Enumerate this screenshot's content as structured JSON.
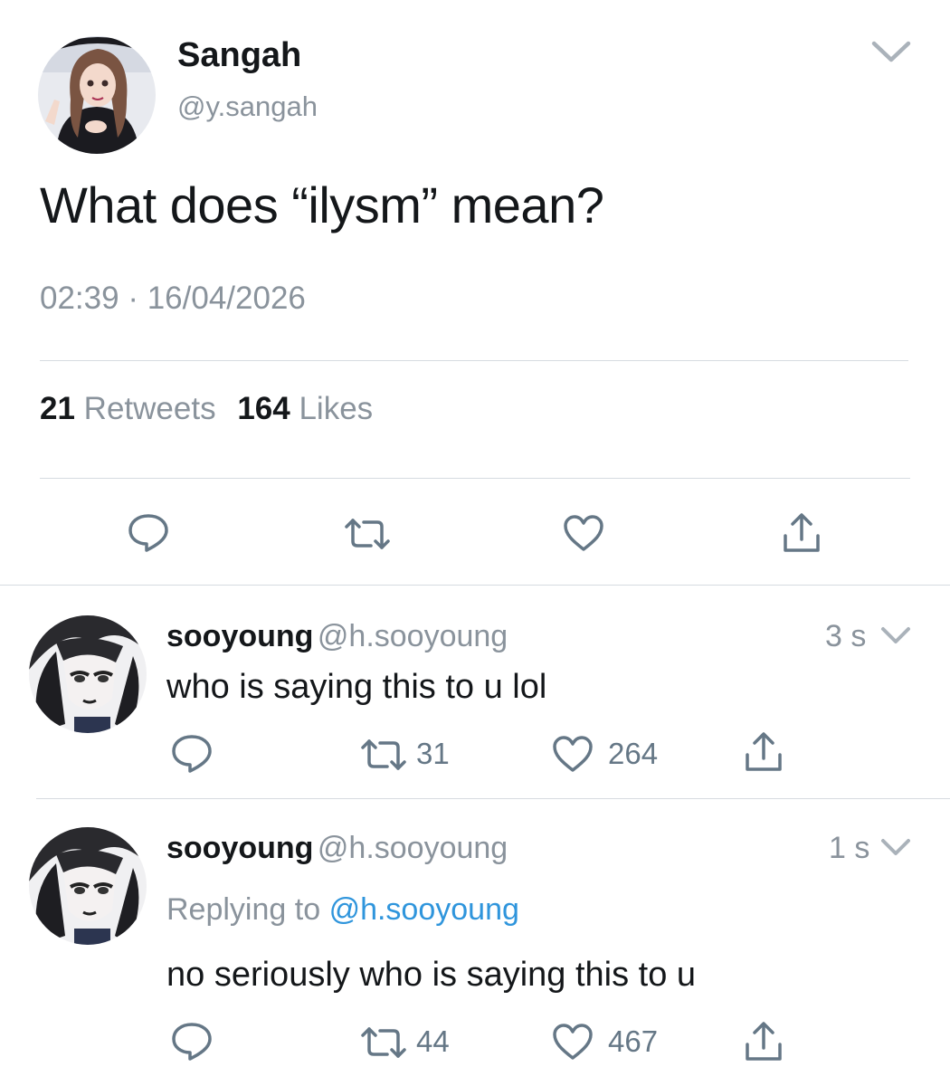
{
  "tweet": {
    "author_name": "Sangah",
    "author_handle": "@y.sangah",
    "text": "What does “ilysm” mean?",
    "time": "02:39",
    "date": "16/04/2026",
    "retweets_count": "21",
    "retweets_label": "Retweets",
    "likes_count": "164",
    "likes_label": "Likes"
  },
  "replies": [
    {
      "name": "sooyoung",
      "handle": "@h.sooyoung",
      "age": "3 s",
      "text": "who is saying this to u lol",
      "retweets": "31",
      "likes": "264"
    },
    {
      "name": "sooyoung",
      "handle": "@h.sooyoung",
      "age": "1 s",
      "replying_prefix": "Replying to",
      "replying_to": "@h.sooyoung",
      "text": "no seriously who is saying this to u",
      "retweets": "44",
      "likes": "467"
    }
  ],
  "colors": {
    "text": "#14171a",
    "muted": "#8a939c",
    "link": "#2f95dc",
    "divider": "#d6dbe0"
  },
  "icons": [
    "chevron-down-icon",
    "reply-icon",
    "retweet-icon",
    "like-icon",
    "share-icon"
  ]
}
